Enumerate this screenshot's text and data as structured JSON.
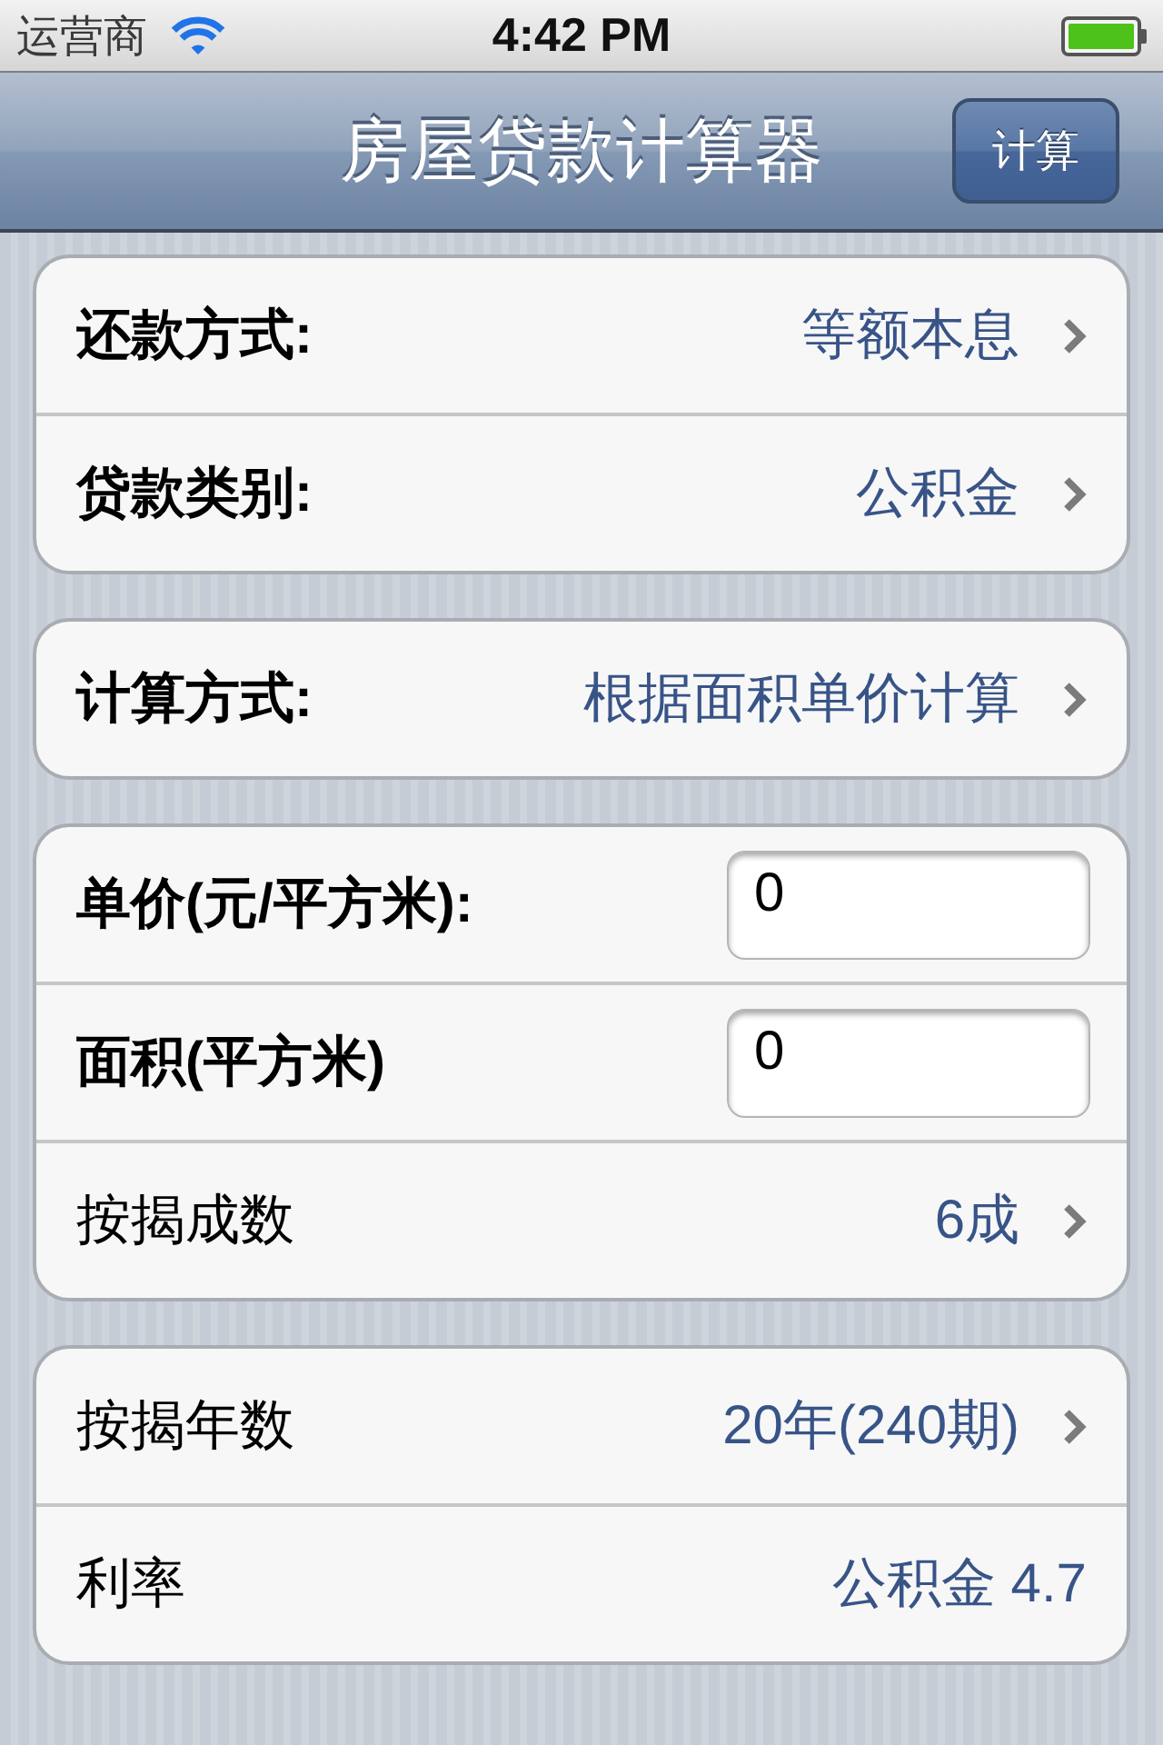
{
  "status_bar": {
    "carrier": "运营商",
    "time": "4:42 PM"
  },
  "nav_bar": {
    "title": "房屋贷款计算器",
    "button": "计算"
  },
  "groups": [
    {
      "rows": [
        {
          "kind": "disclosure",
          "label": "还款方式:",
          "bold": true,
          "value": "等额本息"
        },
        {
          "kind": "disclosure",
          "label": "贷款类别:",
          "bold": true,
          "value": "公积金"
        }
      ]
    },
    {
      "rows": [
        {
          "kind": "disclosure",
          "label": "计算方式:",
          "bold": true,
          "value": "根据面积单价计算"
        }
      ]
    },
    {
      "rows": [
        {
          "kind": "input",
          "label": "单价(元/平方米):",
          "bold": true,
          "value": "0"
        },
        {
          "kind": "input",
          "label": "面积(平方米)",
          "bold": true,
          "value": "0"
        },
        {
          "kind": "disclosure",
          "label": "按揭成数",
          "bold": false,
          "value": "6成"
        }
      ]
    },
    {
      "rows": [
        {
          "kind": "disclosure",
          "label": "按揭年数",
          "bold": false,
          "value": "20年(240期)"
        },
        {
          "kind": "value",
          "label": "利率",
          "bold": false,
          "value": "公积金 4.7"
        }
      ]
    }
  ]
}
